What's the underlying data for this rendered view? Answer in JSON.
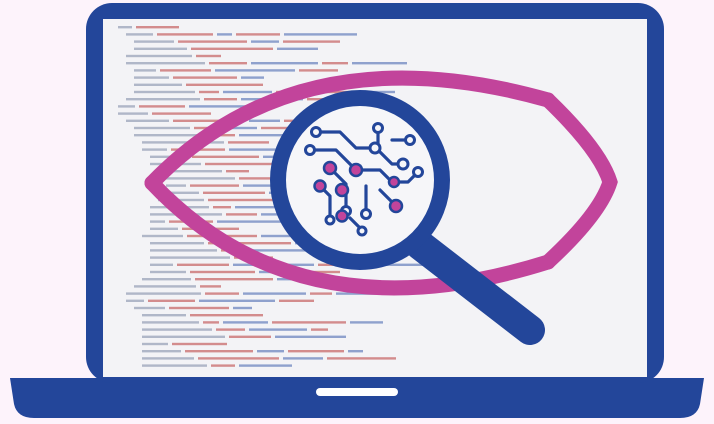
{
  "illustration": {
    "subject": "laptop-with-eye-and-magnifier",
    "icons": [
      "laptop-icon",
      "eye-icon",
      "magnifying-glass-icon",
      "circuit-icon"
    ],
    "colors": {
      "background": "#fdf3fb",
      "laptop_frame": "#23469a",
      "screen": "#f3f3f6",
      "eye_outline": "#c2449b",
      "magnifier": "#23469a",
      "circuit_nodes": "#c2449b",
      "code_gray": "#9aa3b8",
      "code_red": "#c86a6a",
      "code_blue": "#6e86bf"
    }
  }
}
